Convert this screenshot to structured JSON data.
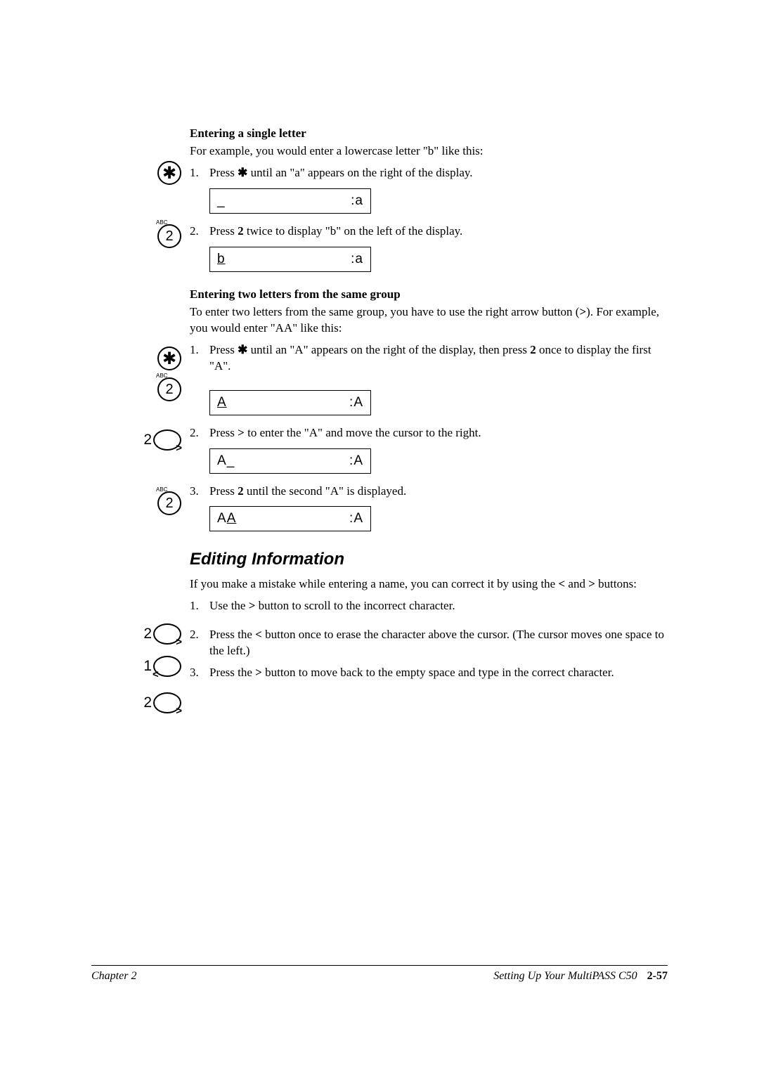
{
  "section1": {
    "heading": "Entering a single letter",
    "intro": "For example, you would enter a lowercase letter \"b\" like this:",
    "step1_pre": "Press ",
    "step1_post": " until an \"a\" appears on the right of the display.",
    "lcd1_left": "_",
    "lcd1_right": ":a",
    "step2_pre": "Press ",
    "step2_key": "2",
    "step2_post": " twice to display \"b\" on the left of the display.",
    "lcd2_left": "b",
    "lcd2_right": ":a"
  },
  "section2": {
    "heading": "Entering two letters from the same group",
    "intro_pre": "To enter two letters from the same group, you have to use the right arrow button (",
    "intro_sym": ">",
    "intro_post": "). For example, you would enter \"AA\" like this:",
    "step1_pre": "Press ",
    "step1_mid": " until an \"A\" appears on the right of the display, then press ",
    "step1_key": "2",
    "step1_post": " once to display the first \"A\".",
    "lcd1_left": "A",
    "lcd1_right": ":A",
    "step2_pre": "Press ",
    "step2_sym": ">",
    "step2_post": " to enter the \"A\" and move the cursor to the right.",
    "lcd2_left_a": "A",
    "lcd2_left_b": "_",
    "lcd2_right": ":A",
    "step3_pre": "Press ",
    "step3_key": "2",
    "step3_post": " until the second \"A\" is displayed.",
    "lcd3_left_a": "A",
    "lcd3_left_b": "A",
    "lcd3_right": ":A"
  },
  "editing": {
    "title": "Editing Information",
    "intro_pre": "If you make a mistake while entering a name, you can correct it by using the ",
    "intro_sym1": "<",
    "intro_mid": " and ",
    "intro_sym2": ">",
    "intro_post": " buttons:",
    "step1_pre": "Use the ",
    "step1_sym": ">",
    "step1_post": " button to scroll to the incorrect character.",
    "step2_pre": "Press the ",
    "step2_sym": "<",
    "step2_post": " button once to erase the character above the cursor. (The cursor moves one space to the left.)",
    "step3_pre": "Press the ",
    "step3_sym": ">",
    "step3_post": " button to move back to the empty space and type in the correct character."
  },
  "footer": {
    "left": "Chapter 2",
    "right": "Setting Up Your MultiPASS C50",
    "page": "2-57"
  },
  "icons": {
    "star": "✱",
    "abc": "ABC",
    "two": "2",
    "one": "1",
    "gt": ">",
    "lt": "<"
  },
  "nums": {
    "n1": "1.",
    "n2": "2.",
    "n3": "3."
  }
}
